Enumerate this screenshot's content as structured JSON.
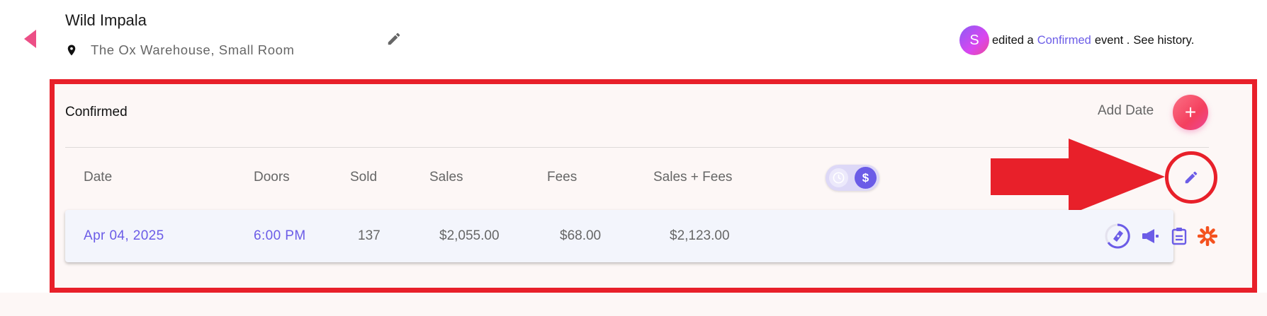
{
  "header": {
    "event_title": "Wild Impala",
    "venue": "The Ox Warehouse, Small Room",
    "history": {
      "avatar_initial": "S",
      "prefix": "edited a",
      "status_link": "Confirmed",
      "suffix": "event .",
      "see_history": "See history."
    }
  },
  "panel": {
    "title": "Confirmed",
    "add_date_label": "Add Date",
    "add_date_icon": "+",
    "columns": [
      "Date",
      "Doors",
      "Sold",
      "Sales",
      "Fees",
      "Sales + Fees"
    ],
    "toggle": {
      "left_icon": "clock-icon",
      "right_icon": "dollar-icon",
      "right_symbol": "$",
      "selected": "dollar"
    },
    "rows": [
      {
        "date": "Apr 04, 2025",
        "doors": "6:00 PM",
        "sold": "137",
        "sales": "$2,055.00",
        "fees": "$68.00",
        "sales_fees": "$2,123.00",
        "icons": [
          "ticket-progress-icon",
          "megaphone-icon",
          "clipboard-icon",
          "asterisk-icon"
        ]
      }
    ]
  },
  "colors": {
    "accent": "#6b5ce7",
    "pink": "#ec4f86",
    "annotation_red": "#e8202a",
    "orange": "#f4511e"
  }
}
